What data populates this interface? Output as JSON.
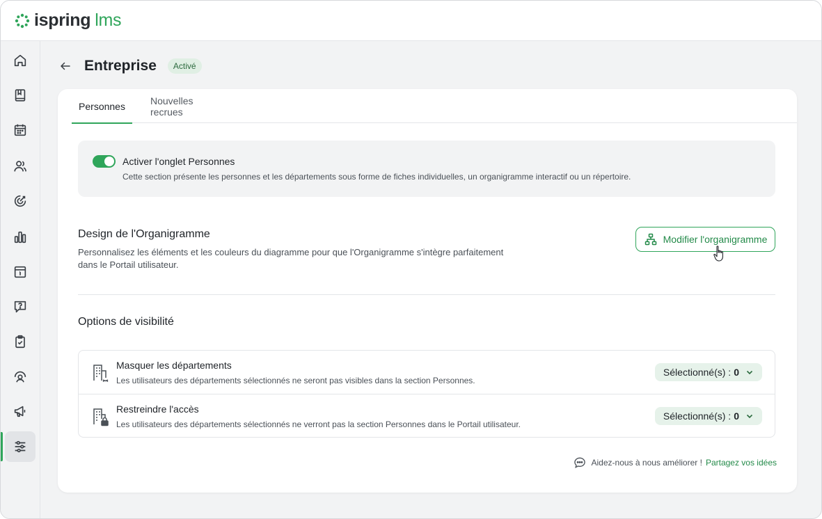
{
  "app": {
    "logo_main": "ispring",
    "logo_sub": "lms",
    "brand_color": "#2fa55a"
  },
  "sidebar": {
    "items": [
      {
        "icon": "home-icon"
      },
      {
        "icon": "book-icon"
      },
      {
        "icon": "calendar-icon"
      },
      {
        "icon": "users-icon"
      },
      {
        "icon": "target-icon"
      },
      {
        "icon": "bar-chart-icon"
      },
      {
        "icon": "info-calendar-icon"
      },
      {
        "icon": "question-icon"
      },
      {
        "icon": "clipboard-check-icon"
      },
      {
        "icon": "user-progress-icon"
      },
      {
        "icon": "megaphone-icon"
      },
      {
        "icon": "settings-sliders-icon",
        "active": true
      }
    ]
  },
  "header": {
    "title": "Entreprise",
    "status": "Activé"
  },
  "tabs": [
    {
      "label": "Personnes",
      "active": true
    },
    {
      "label": "Nouvelles recrues",
      "active": false
    }
  ],
  "notice": {
    "toggle_on": true,
    "title": "Activer l'onglet Personnes",
    "description": "Cette section présente les personnes et les départements sous forme de fiches individuelles, un organigramme interactif ou un répertoire."
  },
  "org_design": {
    "title": "Design de l'Organigramme",
    "description": "Personnalisez les éléments et les couleurs du diagramme pour que l'Organigramme s'intègre parfaitement dans le Portail utilisateur.",
    "button_label": "Modifier l'organigramme"
  },
  "visibility": {
    "title": "Options de visibilité",
    "options": [
      {
        "title": "Masquer les départements",
        "description": "Les utilisateurs des départements sélectionnés ne seront pas visibles dans la section Personnes.",
        "select_label": "Sélectionné(s) :",
        "select_count": "0"
      },
      {
        "title": "Restreindre l'accès",
        "description": "Les utilisateurs des départements sélectionnés ne verront pas la section Personnes dans le Portail utilisateur.",
        "select_label": "Sélectionné(s) :",
        "select_count": "0"
      }
    ]
  },
  "feedback": {
    "text": "Aidez-nous à nous améliorer !",
    "link": "Partagez vos idées"
  }
}
